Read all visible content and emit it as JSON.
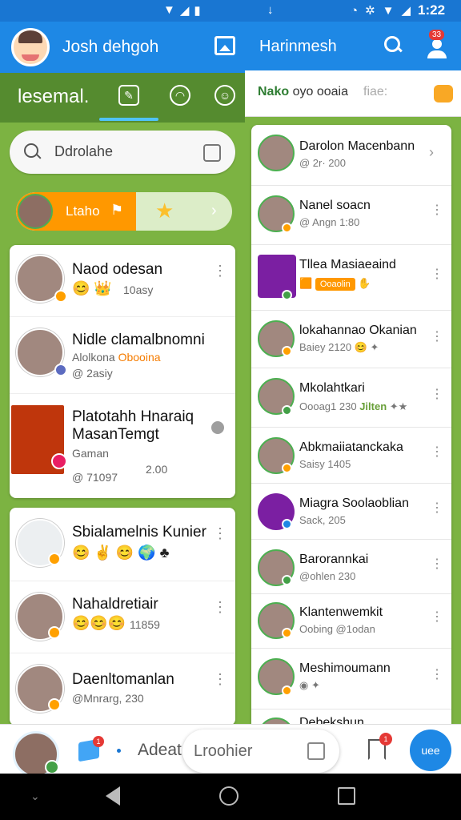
{
  "status_bar": {
    "time": "1:22"
  },
  "app_bar": {
    "title_left": "Josh dehgoh",
    "title_right": "Harinmesh",
    "badge": "33"
  },
  "left_tabs": {
    "label": "lesemal.",
    "icon2": "☺"
  },
  "right_header": {
    "label": "Nako",
    "label_rest": " oyo ooaia",
    "faint": "fiae:"
  },
  "search": {
    "placeholder": "Ddrolahe"
  },
  "promo": {
    "text": "Ltaho"
  },
  "left_list": [
    {
      "name": "Naod odesan",
      "emojis": "😊 👑",
      "sub": "10asy"
    },
    {
      "name": "Nidle clamalbnomni",
      "sub": "Alolkona",
      "highlight": "Obooina",
      "sub2": "@ 2asiy"
    },
    {
      "name": "Platotahh Hnaraiq",
      "name2": "MasanTemgt",
      "sub": "Gaman",
      "sub2": "2.00",
      "sub3": "@ 71097"
    },
    {
      "name": "Sbialamelnis Kunier",
      "emojis": "😊 ✌ 😊 🌍 ♣"
    },
    {
      "name": "Nahaldretiair",
      "emojis": "😊😊😊",
      "sub": "11859"
    },
    {
      "name": "Daenltomanlan",
      "sub": "@Mnrarg, 230"
    }
  ],
  "right_list": [
    {
      "name": "Darolon Macenbann",
      "sub": "@ 2r· 200"
    },
    {
      "name": "Nanel soacn",
      "sub": "@ Angn 1:80"
    },
    {
      "name": "Tllea Masiaeaind",
      "tag": "Ooaolin"
    },
    {
      "name": "lokahannao Okanian",
      "sub": "Baiey 2120"
    },
    {
      "name": "Mkolahtkari",
      "sub": "Oooag1 230",
      "extra": "Jilten"
    },
    {
      "name": "Abkmaiiatanckaka",
      "sub": "Saisy 1405"
    },
    {
      "name": "Miagra Soolaoblian",
      "sub": "Sack, 205"
    },
    {
      "name": "Barorannkai",
      "sub": "@ohlen 230"
    },
    {
      "name": "Klantenwemkit",
      "sub": "Oobing @1odan"
    },
    {
      "name": "Meshimoumann",
      "sub": ""
    },
    {
      "name": "Debekshun",
      "sub": ""
    }
  ],
  "bottom_bar": {
    "label": "Adeat",
    "pill_text": "Lroohier",
    "cube_badge": "1",
    "flag_badge": "1",
    "fab": "uee"
  }
}
